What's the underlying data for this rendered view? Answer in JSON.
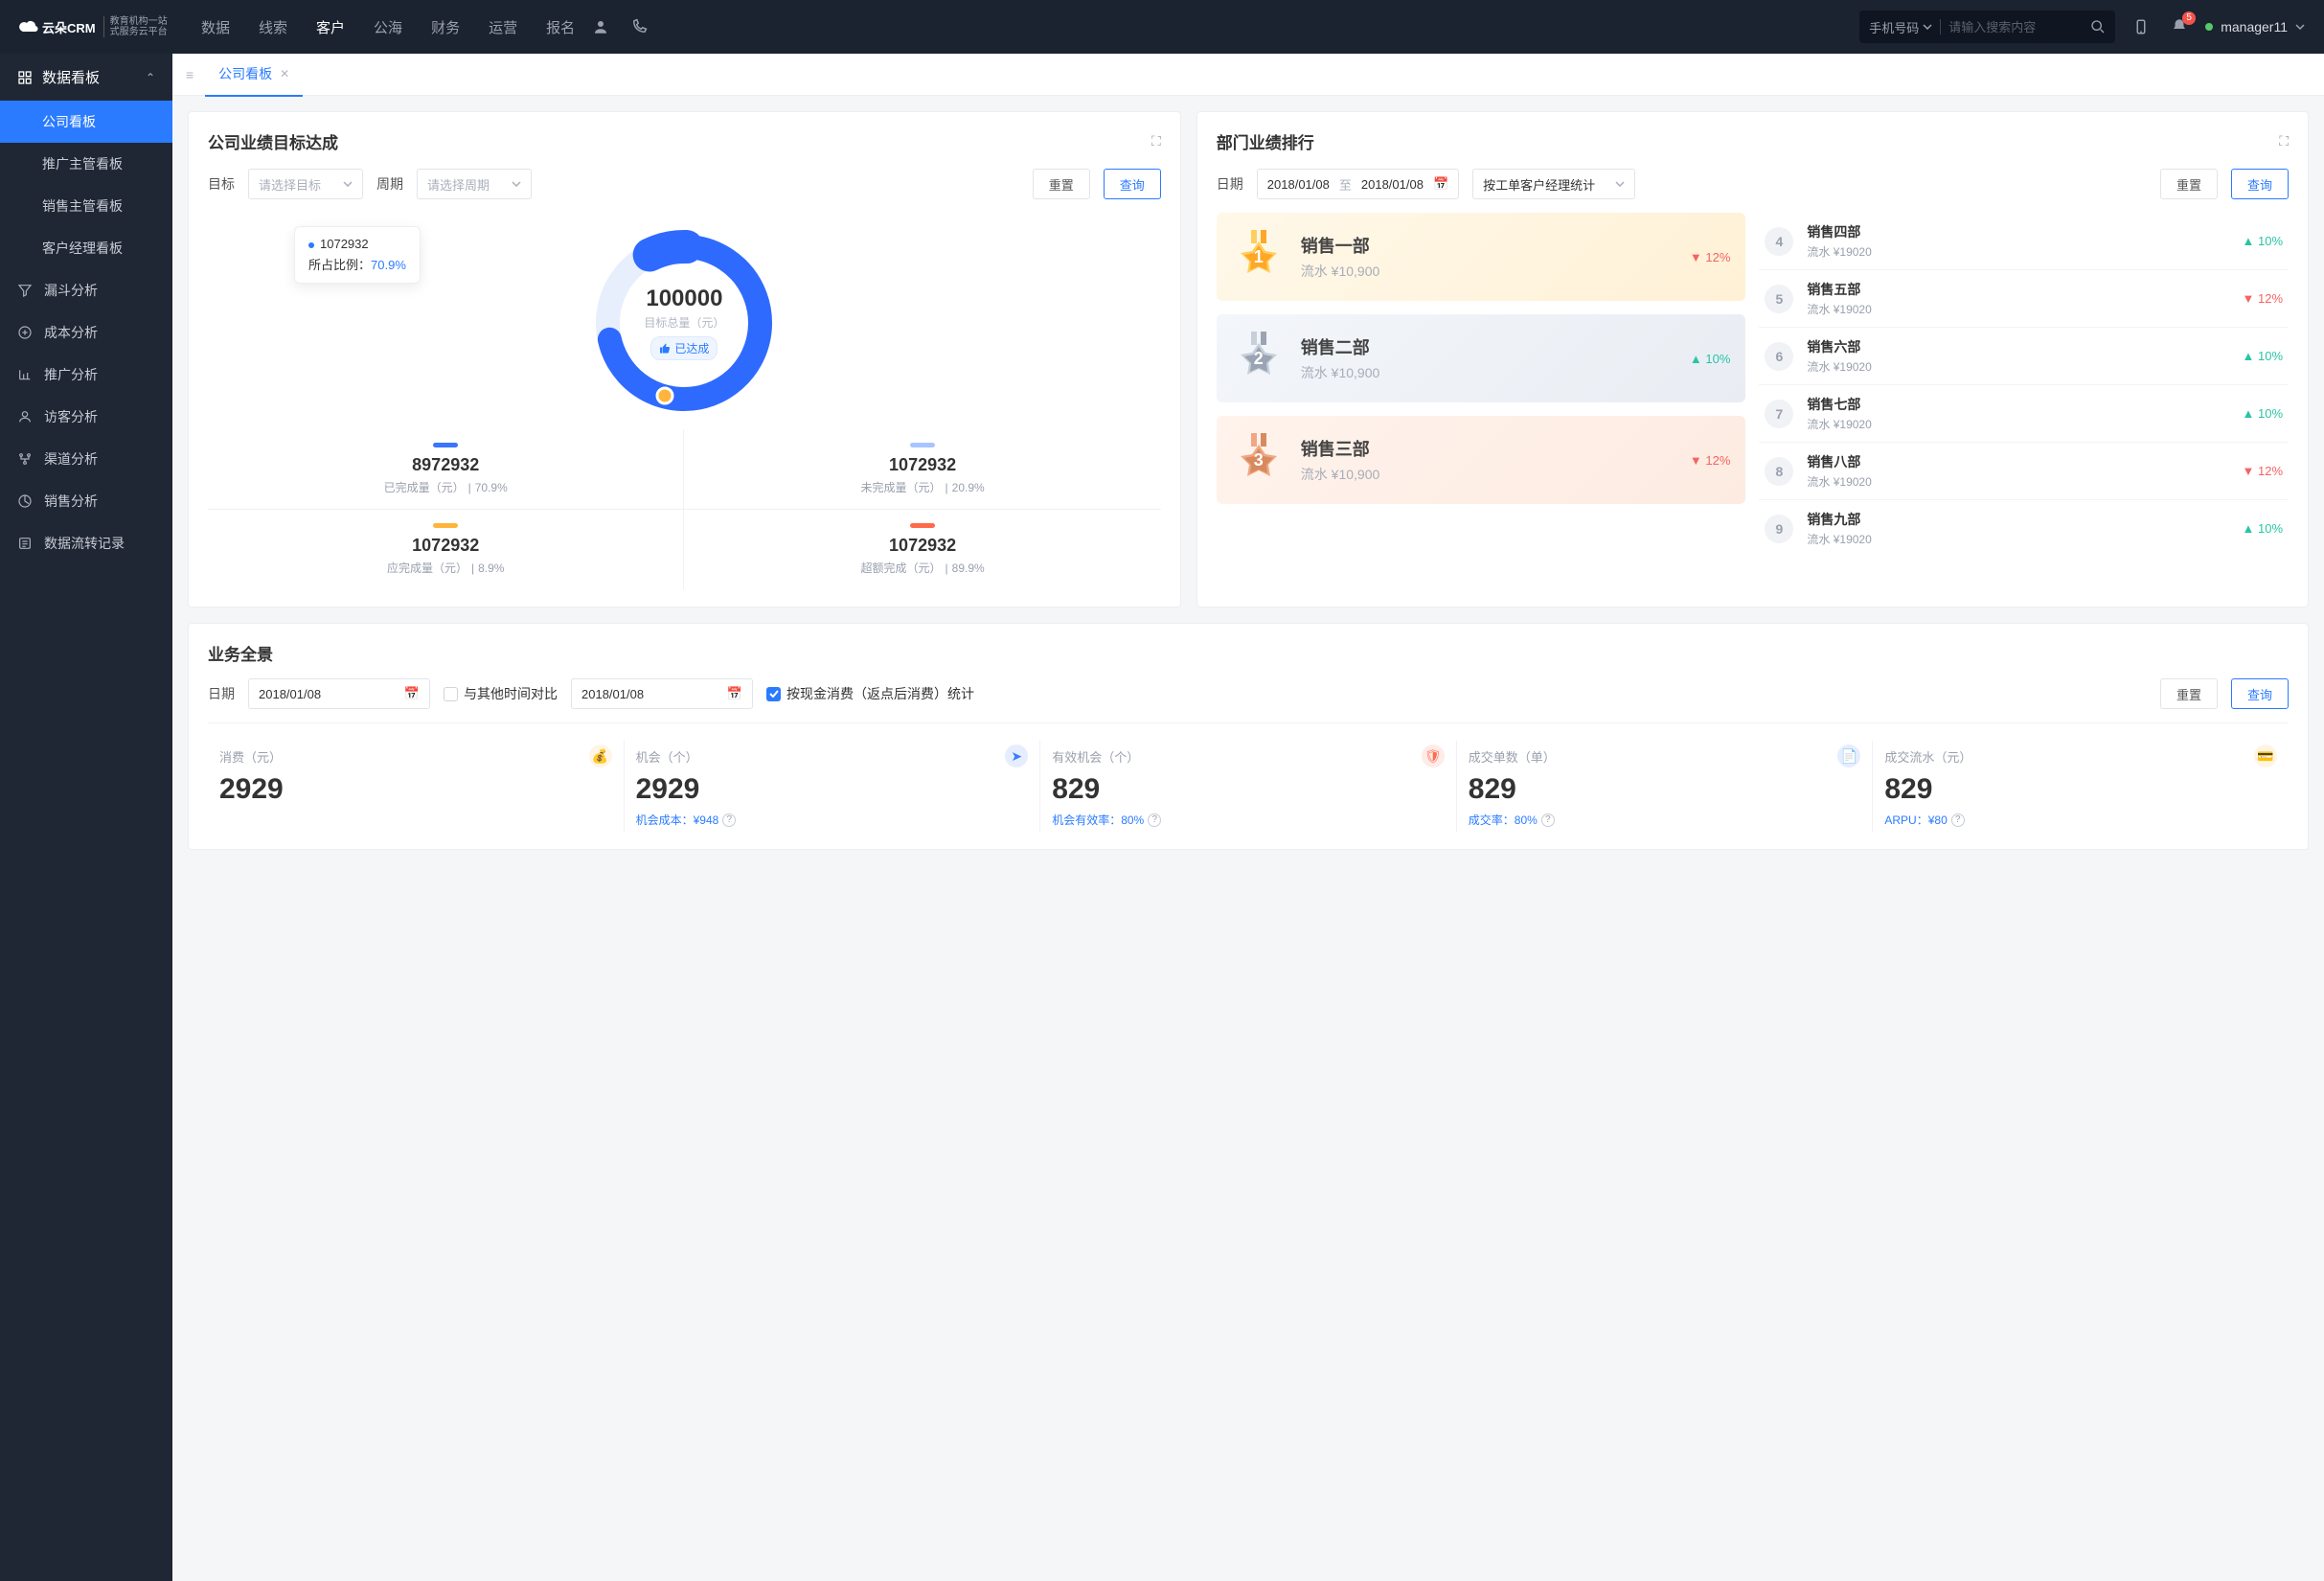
{
  "topnav": {
    "brand": "云朵CRM",
    "brand_sub_l1": "教育机构一站",
    "brand_sub_l2": "式服务云平台",
    "tabs": [
      "数据",
      "线索",
      "客户",
      "公海",
      "财务",
      "运营",
      "报名"
    ],
    "active_tab": "客户",
    "search_type": "手机号码",
    "search_placeholder": "请输入搜索内容",
    "notif_count": "5",
    "user": "manager11"
  },
  "sidebar": {
    "head": "数据看板",
    "sub": [
      "公司看板",
      "推广主管看板",
      "销售主管看板",
      "客户经理看板"
    ],
    "main": [
      "漏斗分析",
      "成本分析",
      "推广分析",
      "访客分析",
      "渠道分析",
      "销售分析",
      "数据流转记录"
    ]
  },
  "tabbar": {
    "tab": "公司看板"
  },
  "cardA": {
    "title": "公司业绩目标达成",
    "label_target": "目标",
    "sel_target": "请选择目标",
    "label_period": "周期",
    "sel_period": "请选择周期",
    "btn_reset": "重置",
    "btn_query": "查询",
    "tooltip_value": "1072932",
    "tooltip_label": "所占比例：",
    "tooltip_pct": "70.9%",
    "donut_main": "100000",
    "donut_sub": "目标总量（元）",
    "donut_badge": "已达成",
    "metrics": [
      {
        "bar": "#3a74ff",
        "value": "8972932",
        "label": "已完成量（元）",
        "pct": "70.9%"
      },
      {
        "bar": "#a9c5ff",
        "value": "1072932",
        "label": "未完成量（元）",
        "pct": "20.9%"
      },
      {
        "bar": "#ffb43a",
        "value": "1072932",
        "label": "应完成量（元）",
        "pct": "8.9%"
      },
      {
        "bar": "#ff6a4a",
        "value": "1072932",
        "label": "超额完成（元）",
        "pct": "89.9%"
      }
    ]
  },
  "cardB": {
    "title": "部门业绩排行",
    "label_date": "日期",
    "date_from": "2018/01/08",
    "date_sep": "至",
    "date_to": "2018/01/08",
    "sel_stat": "按工单客户经理统计",
    "btn_reset": "重置",
    "btn_query": "查询",
    "top3": [
      {
        "name": "销售一部",
        "sub": "流水 ¥10,900",
        "pct": "12%",
        "dir": "down",
        "medal": "gold",
        "num": "1"
      },
      {
        "name": "销售二部",
        "sub": "流水 ¥10,900",
        "pct": "10%",
        "dir": "up",
        "medal": "silver",
        "num": "2"
      },
      {
        "name": "销售三部",
        "sub": "流水 ¥10,900",
        "pct": "12%",
        "dir": "down",
        "medal": "bronze",
        "num": "3"
      }
    ],
    "rest": [
      {
        "rank": "4",
        "name": "销售四部",
        "sub": "流水 ¥19020",
        "pct": "10%",
        "dir": "up"
      },
      {
        "rank": "5",
        "name": "销售五部",
        "sub": "流水 ¥19020",
        "pct": "12%",
        "dir": "down"
      },
      {
        "rank": "6",
        "name": "销售六部",
        "sub": "流水 ¥19020",
        "pct": "10%",
        "dir": "up"
      },
      {
        "rank": "7",
        "name": "销售七部",
        "sub": "流水 ¥19020",
        "pct": "10%",
        "dir": "up"
      },
      {
        "rank": "8",
        "name": "销售八部",
        "sub": "流水 ¥19020",
        "pct": "12%",
        "dir": "down"
      },
      {
        "rank": "9",
        "name": "销售九部",
        "sub": "流水 ¥19020",
        "pct": "10%",
        "dir": "up"
      }
    ]
  },
  "cardC": {
    "title": "业务全景",
    "label_date": "日期",
    "date": "2018/01/08",
    "cmp_label": "与其他时间对比",
    "cmp_date": "2018/01/08",
    "chk_label": "按现金消费（返点后消费）统计",
    "btn_reset": "重置",
    "btn_query": "查询",
    "stats": [
      {
        "lab": "消费（元）",
        "val": "2929",
        "foot": "",
        "pill": "#ffb43a"
      },
      {
        "lab": "机会（个）",
        "val": "2929",
        "foot": "机会成本：¥948",
        "pill": "#3a7bff"
      },
      {
        "lab": "有效机会（个）",
        "val": "829",
        "foot": "机会有效率：80%",
        "pill": "#ff6a4a"
      },
      {
        "lab": "成交单数（单）",
        "val": "829",
        "foot": "成交率：80%",
        "pill": "#3a7bff"
      },
      {
        "lab": "成交流水（元）",
        "val": "829",
        "foot": "ARPU：¥80",
        "pill": "#ffb43a"
      }
    ]
  },
  "chart_data": {
    "type": "pie",
    "title": "目标总量（元）",
    "center_value": 100000,
    "series": [
      {
        "name": "已完成",
        "value": 8972932,
        "color": "#3a74ff"
      },
      {
        "name": "未完成",
        "value": 1072932,
        "color": "#a9c5ff"
      }
    ],
    "tooltip": {
      "name": "",
      "value": 1072932,
      "pct": 70.9
    }
  }
}
